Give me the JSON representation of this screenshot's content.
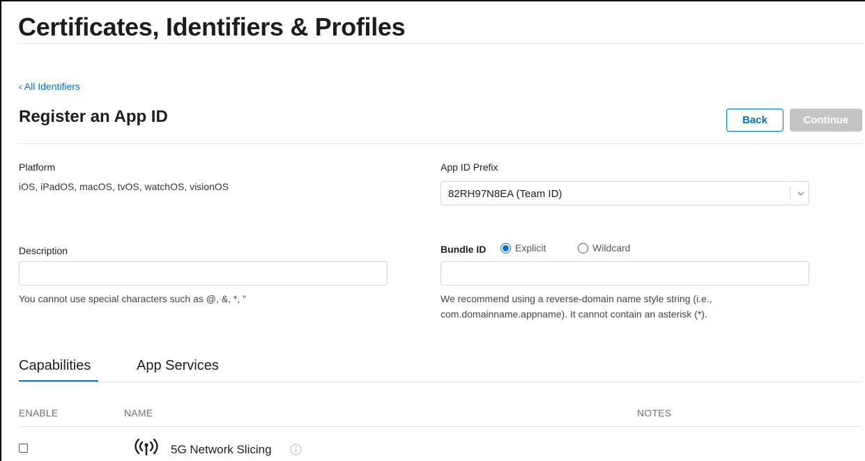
{
  "header": {
    "title": "Certificates, Identifiers & Profiles"
  },
  "nav": {
    "back_link": "‹ All Identifiers"
  },
  "section": {
    "title": "Register an App ID"
  },
  "actions": {
    "back_label": "Back",
    "continue_label": "Continue"
  },
  "platform": {
    "label": "Platform",
    "value": "iOS, iPadOS, macOS, tvOS, watchOS, visionOS"
  },
  "app_id_prefix": {
    "label": "App ID Prefix",
    "selected": "82RH97N8EA (Team ID)"
  },
  "description": {
    "label": "Description",
    "value": "",
    "placeholder": "",
    "hint": "You cannot use special characters such as @, &, *, \""
  },
  "bundle_id": {
    "label": "Bundle ID",
    "options": [
      {
        "label": "Explicit",
        "selected": true
      },
      {
        "label": "Wildcard",
        "selected": false
      }
    ],
    "value": "",
    "placeholder": "",
    "hint_line1": "We recommend using a reverse-domain name style string (i.e.,",
    "hint_line2": "com.domainname.appname). It cannot contain an asterisk (*)."
  },
  "tabs": [
    {
      "label": "Capabilities",
      "active": true
    },
    {
      "label": "App Services",
      "active": false
    }
  ],
  "table": {
    "columns": [
      "ENABLE",
      "NAME",
      "NOTES"
    ],
    "rows": [
      {
        "enabled": false,
        "icon": "antenna-icon",
        "name": "5G Network Slicing",
        "notes": ""
      }
    ]
  },
  "colors": {
    "accent": "#0070c9",
    "disabled_button": "#c4c4c4",
    "text": "#1d1d1f"
  }
}
